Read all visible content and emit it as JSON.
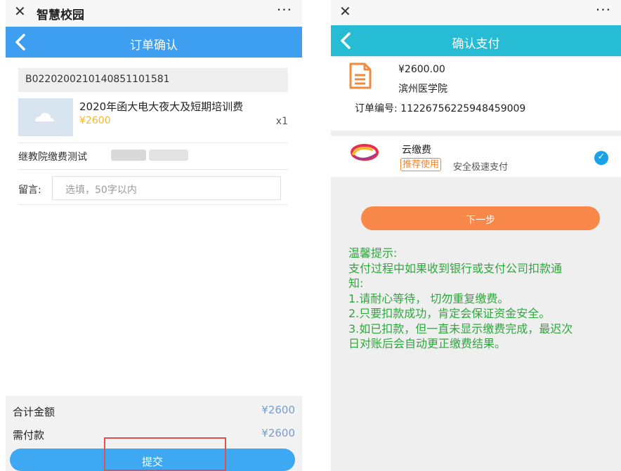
{
  "left": {
    "close_icon": "close-icon",
    "app_title": "智慧校园",
    "more_label": "···",
    "page_title": "订单确认",
    "order_no": "B022020021014085110158​1",
    "product": {
      "title": "2020年函大电大夜大及短期培训费",
      "price": "¥2600",
      "qty": "x1"
    },
    "shop_name": "继教院缴费测试",
    "remark_label": "留言:",
    "remark_placeholder": "选填，50字以内",
    "total_label": "合计金额",
    "total_value": "¥2600",
    "due_label": "需付款",
    "due_value": "¥2600",
    "submit_label": "提交",
    "colors": {
      "nav": "#3e9ff1",
      "price": "#f5b82e",
      "button": "#3ea8f2",
      "highlight": "#e35050"
    }
  },
  "right": {
    "close_icon": "close-icon",
    "more_label": "···",
    "page_title": "确认支付",
    "amount": "¥2600.00",
    "school": "滨州医学院",
    "order_label": "订单编号:",
    "order_no": "112267562259484590​09",
    "pay_method": "云缴费",
    "recommend_badge": "推荐使用",
    "pay_desc": "安全极速支付",
    "next_label": "下一步",
    "tips": [
      "温馨提示:",
      "支付过程中如果收到银行或支付公司扣款通",
      "知:",
      "1.请耐心等待， 切勿重复缴费。",
      "2.只要扣款成功，肯定会保证资金安全。",
      "3.如已扣款，但一直未显示缴费完成，最迟次",
      "日对账后会自动更正缴费结果。"
    ],
    "colors": {
      "nav": "#25bcd4",
      "button": "#f7884a",
      "tips": "#2fa73d",
      "badge": "#f0852e"
    }
  }
}
